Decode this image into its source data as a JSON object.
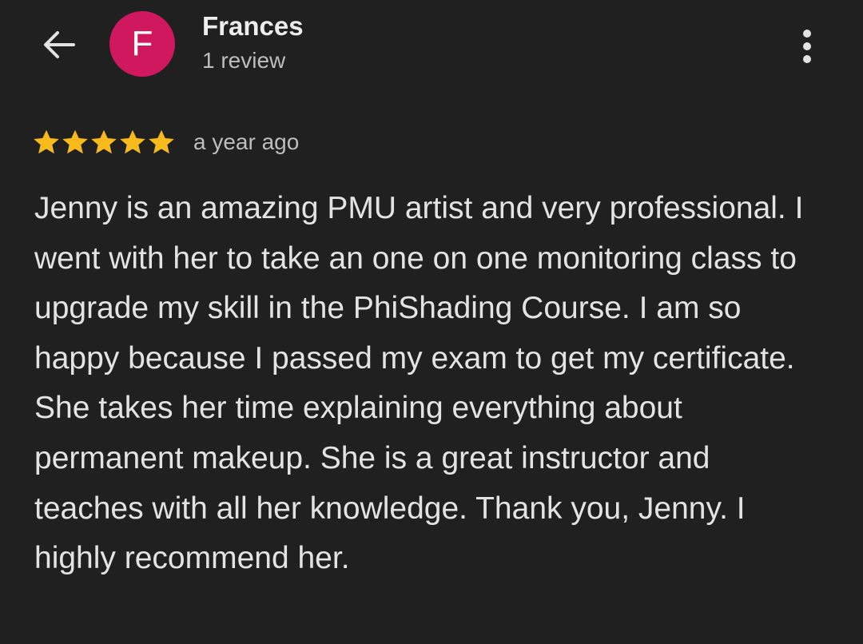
{
  "header": {
    "back_icon": "arrow-left-icon",
    "avatar_letter": "F",
    "avatar_color": "#d0185f",
    "reviewer_name": "Frances",
    "review_count": "1 review",
    "more_icon": "more-vertical-icon"
  },
  "review": {
    "rating": 5,
    "rating_max": 5,
    "star_color": "#f8bb1b",
    "time": "a year ago",
    "text": "Jenny is an amazing PMU artist and very professional. I went with her to take an one on one monitoring class to upgrade my skill in the PhiShading Course. I am so happy because I passed my exam to get my certificate. She takes her time explaining everything about permanent makeup. She is a great instructor and teaches with all her knowledge. Thank you, Jenny. I highly recommend her."
  },
  "colors": {
    "background": "#202020",
    "text": "#e3e3e3",
    "secondary_text": "#bdbdbd"
  }
}
